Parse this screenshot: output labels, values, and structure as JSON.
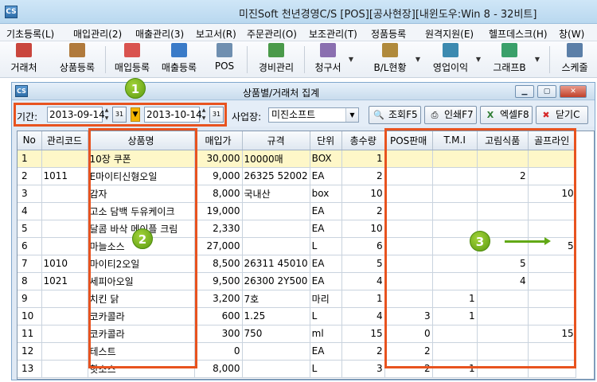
{
  "window": {
    "title": "미진Soft 천년경영C/S [POS][공사현장][내윈도우:Win 8 - 32비트]",
    "icon_text": "CS"
  },
  "menu": [
    "기초등록(L)",
    "매입관리(2)",
    "매출관리(3)",
    "보고서(R)",
    "주문관리(O)",
    "보조관리(T)",
    "정품등록",
    "원격지원(E)",
    "헬프데스크(H)",
    "창(W)"
  ],
  "toolbar": [
    {
      "label": "거래처",
      "icon": "client-card-icon",
      "color": "#c9463d"
    },
    {
      "label": "상품등록",
      "icon": "product-box-icon",
      "color": "#b07a3c"
    },
    {
      "label": "매입등록",
      "icon": "purchase-entry-icon",
      "color": "#d9534f"
    },
    {
      "label": "매출등록",
      "icon": "sales-entry-icon",
      "color": "#3a7bc8"
    },
    {
      "label": "POS",
      "icon": "pos-terminal-icon",
      "color": "#6f8fb0"
    },
    {
      "label": "경비관리",
      "icon": "expense-ledger-icon",
      "color": "#4a9a4a"
    },
    {
      "label": "청구서",
      "icon": "invoice-icon",
      "color": "#8a6fb0"
    },
    {
      "label": "B/L현황",
      "icon": "bl-status-icon",
      "color": "#b08a3c"
    },
    {
      "label": "영업이익",
      "icon": "profit-chart-icon",
      "color": "#3c8ab0"
    },
    {
      "label": "그래프B",
      "icon": "bar-graph-icon",
      "color": "#3aa06a"
    },
    {
      "label": "스케줄",
      "icon": "calendar-icon",
      "color": "#5b7fa8"
    }
  ],
  "child": {
    "title": "상품별/거래처 집계",
    "icon_text": "CS",
    "filter": {
      "period_label": "기간:",
      "date_from": "2013-09-14",
      "date_to": "2013-10-14",
      "calendar_day": "31",
      "site_label": "사업장:",
      "site_value": "미진소프트"
    },
    "buttons": {
      "search": "조회F5",
      "print": "인쇄F7",
      "excel": "엑셀F8",
      "close": "닫기C"
    }
  },
  "annotations": {
    "badge1": "1",
    "badge2": "2",
    "badge3": "3"
  },
  "table": {
    "columns": [
      "No",
      "관리코드",
      "상품명",
      "매입가",
      "규격",
      "단위",
      "총수량",
      "POS판매",
      "T.M.I",
      "고림식품",
      "골프라인"
    ],
    "rows": [
      [
        "1",
        "",
        "10장 쿠폰",
        "30,000",
        "10000매",
        "BOX",
        "1",
        "",
        "",
        "",
        ""
      ],
      [
        "2",
        "1011",
        "E마이티신형오일",
        "9,000",
        "26325 52002",
        "EA",
        "2",
        "",
        "",
        "2",
        ""
      ],
      [
        "3",
        "",
        "감자",
        "8,000",
        "국내산",
        "box",
        "10",
        "",
        "",
        "",
        "10"
      ],
      [
        "4",
        "",
        "고소 담백 두유케이크",
        "19,000",
        "",
        "EA",
        "2",
        "",
        "",
        "",
        ""
      ],
      [
        "5",
        "",
        "달콤 바삭 메이플 크림",
        "2,330",
        "",
        "EA",
        "10",
        "",
        "",
        "",
        ""
      ],
      [
        "6",
        "",
        "마늘소스",
        "27,000",
        "",
        "L",
        "6",
        "",
        "",
        "",
        "5"
      ],
      [
        "7",
        "1010",
        "마이티2오일",
        "8,500",
        "26311 45010",
        "EA",
        "5",
        "",
        "",
        "5",
        ""
      ],
      [
        "8",
        "1021",
        "세피아오일",
        "9,500",
        "26300 2Y500",
        "EA",
        "4",
        "",
        "",
        "4",
        ""
      ],
      [
        "9",
        "",
        "치킨 닭",
        "3,200",
        "7호",
        "마리",
        "1",
        "",
        "1",
        "",
        ""
      ],
      [
        "10",
        "",
        "코카콜라",
        "600",
        "1.25",
        "L",
        "4",
        "3",
        "1",
        "",
        ""
      ],
      [
        "11",
        "",
        "코카콜라",
        "300",
        "750",
        "ml",
        "15",
        "0",
        "",
        "",
        "15"
      ],
      [
        "12",
        "",
        "테스트",
        "0",
        "",
        "EA",
        "2",
        "2",
        "",
        "",
        ""
      ],
      [
        "13",
        "",
        "핫소스",
        "8,000",
        "",
        "L",
        "3",
        "2",
        "1",
        "",
        ""
      ]
    ]
  },
  "colors": {
    "highlight": "#e8531f",
    "badge": "#6aac17",
    "selected_row": "#fef7c8"
  }
}
